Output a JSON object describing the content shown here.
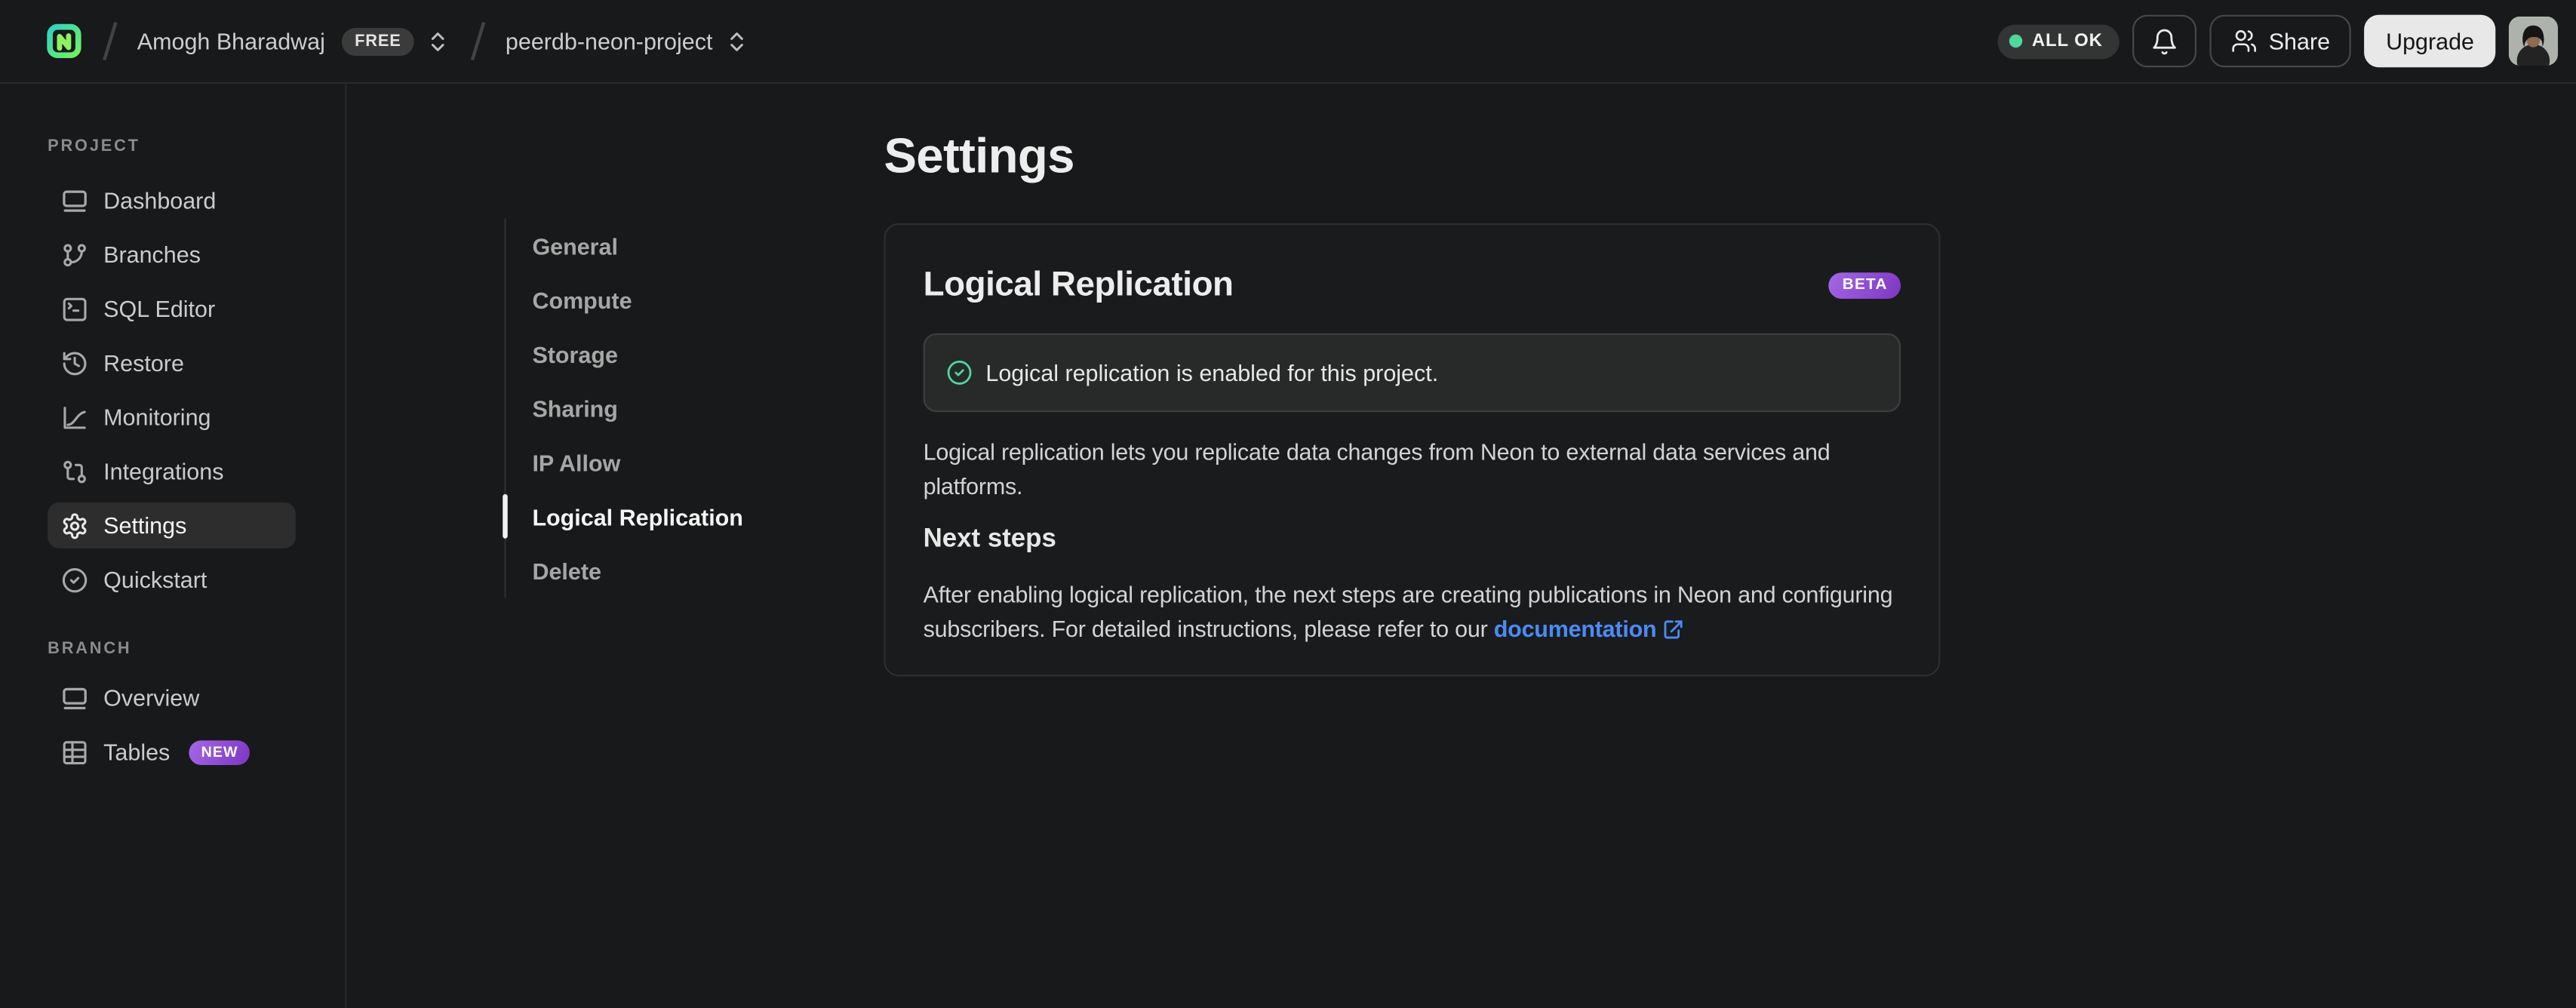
{
  "topbar": {
    "org": "Amogh Bharadwaj",
    "org_badge": "FREE",
    "project": "peerdb-neon-project",
    "status": "ALL OK",
    "share_label": "Share",
    "upgrade_label": "Upgrade"
  },
  "sidebar": {
    "project_section": "PROJECT",
    "branch_section": "BRANCH",
    "project_items": [
      {
        "label": "Dashboard",
        "icon": "dashboard-icon"
      },
      {
        "label": "Branches",
        "icon": "git-branch-icon"
      },
      {
        "label": "SQL Editor",
        "icon": "terminal-icon"
      },
      {
        "label": "Restore",
        "icon": "history-icon"
      },
      {
        "label": "Monitoring",
        "icon": "chart-icon"
      },
      {
        "label": "Integrations",
        "icon": "integrations-icon"
      },
      {
        "label": "Settings",
        "icon": "gear-icon",
        "active": true
      },
      {
        "label": "Quickstart",
        "icon": "check-circle-icon"
      }
    ],
    "branch_items": [
      {
        "label": "Overview",
        "icon": "window-icon"
      },
      {
        "label": "Tables",
        "icon": "table-icon",
        "badge": "NEW"
      }
    ]
  },
  "settings_nav": {
    "items": [
      {
        "label": "General"
      },
      {
        "label": "Compute"
      },
      {
        "label": "Storage"
      },
      {
        "label": "Sharing"
      },
      {
        "label": "IP Allow"
      },
      {
        "label": "Logical Replication",
        "active": true
      },
      {
        "label": "Delete"
      }
    ]
  },
  "main": {
    "page_title": "Settings",
    "card": {
      "title": "Logical Replication",
      "badge": "BETA",
      "alert_text": "Logical replication is enabled for this project.",
      "description": "Logical replication lets you replicate data changes from Neon to external data services and platforms.",
      "next_steps_heading": "Next steps",
      "next_steps_text": "After enabling logical replication, the next steps are creating publications in Neon and configuring subscribers. For detailed instructions, please refer to our ",
      "doc_link_label": "documentation"
    }
  },
  "colors": {
    "ok_green": "#50d79b",
    "badge_purple_start": "#a468e6",
    "badge_purple_end": "#7c36c2",
    "link_blue": "#4c8bf5",
    "background": "#18191a"
  }
}
